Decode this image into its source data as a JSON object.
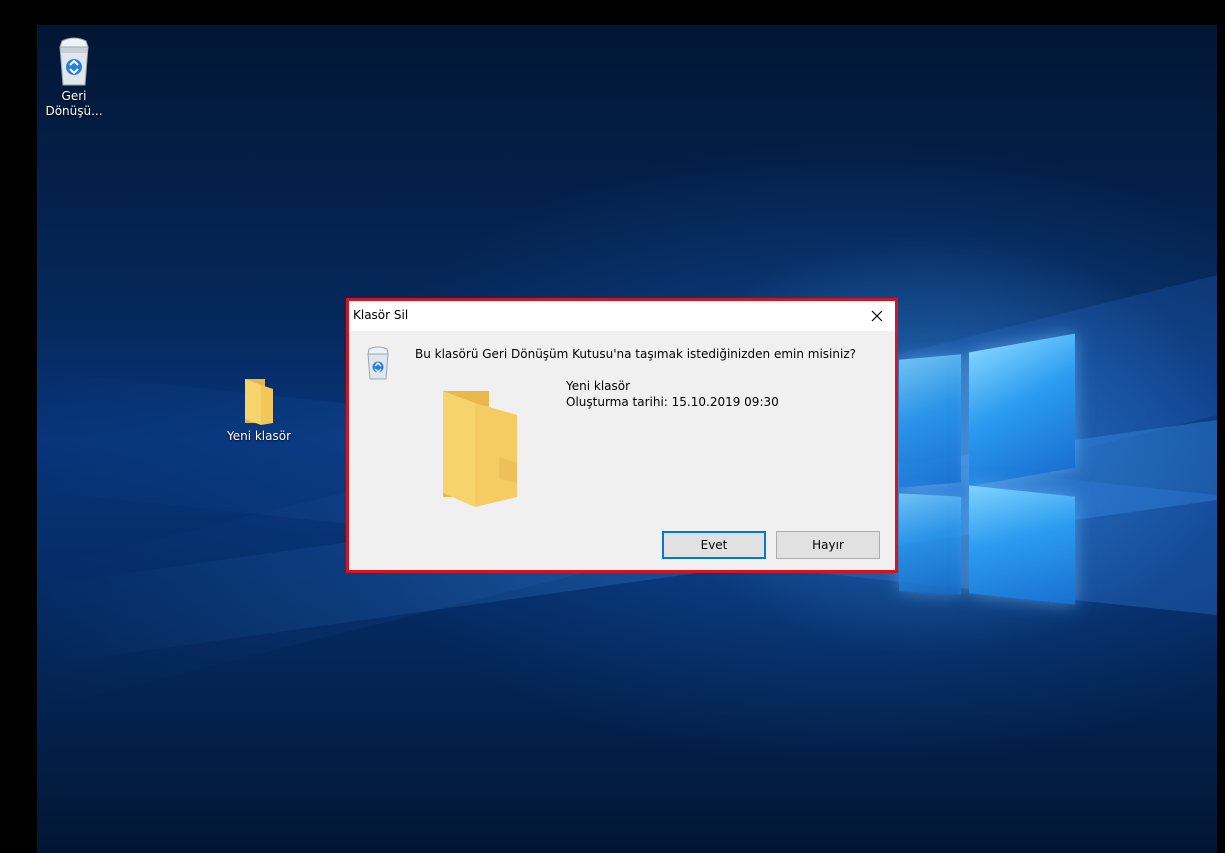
{
  "desktop": {
    "icons": [
      {
        "label": "Geri\nDönüşü...",
        "icon": "recycle-bin-icon"
      },
      {
        "label": "Yeni klasör",
        "icon": "folder-icon"
      }
    ]
  },
  "dialog": {
    "title": "Klasör Sil",
    "question": "Bu klasörü Geri Dönüşüm Kutusu'na taşımak istediğinizden emin misiniz?",
    "item_name": "Yeni klasör",
    "item_date": "Oluşturma tarihi: 15.10.2019 09:30",
    "yes_label": "Evet",
    "no_label": "Hayır",
    "highlight_color": "#d4141e"
  }
}
